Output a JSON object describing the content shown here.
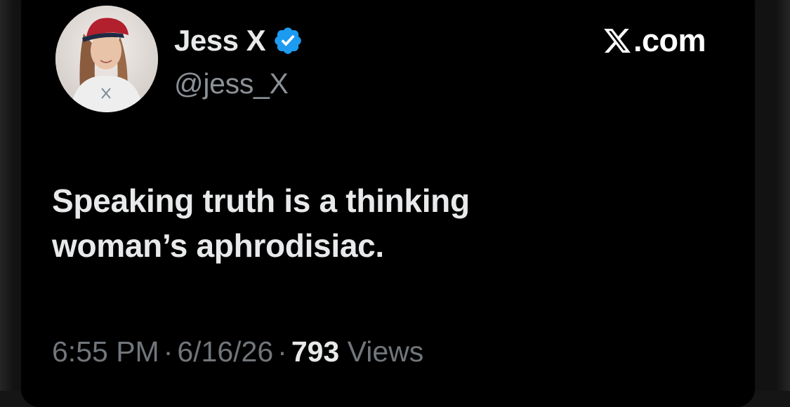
{
  "tweet": {
    "author": {
      "display_name": "Jess X",
      "handle": "@jess_X",
      "verified": true,
      "verified_color": "#1d9bf0",
      "avatar_icon": "profile-photo"
    },
    "brand": {
      "logo_icon": "x-logo-icon",
      "text": ".com"
    },
    "text_lines": [
      "Speaking truth is a thinking",
      "woman’s aphrodisiac."
    ],
    "meta": {
      "time": "6:55 PM",
      "separator": "·",
      "date": "6/16/26",
      "views_count": "793",
      "views_label": "Views"
    }
  }
}
